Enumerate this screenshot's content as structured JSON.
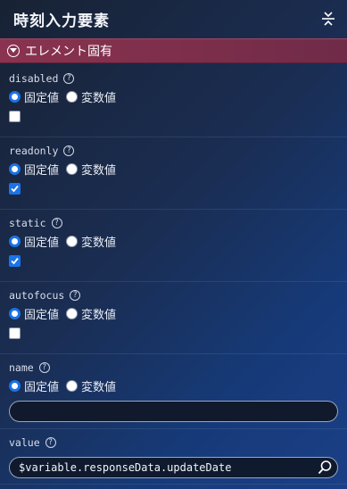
{
  "header": {
    "title": "時刻入力要素"
  },
  "section": {
    "label": "エレメント固有"
  },
  "radio_labels": {
    "fixed": "固定値",
    "variable": "変数値"
  },
  "help_glyph": "?",
  "properties": [
    {
      "name": "disabled",
      "mode": "fixed",
      "checked": false
    },
    {
      "name": "readonly",
      "mode": "fixed",
      "checked": true
    },
    {
      "name": "static",
      "mode": "fixed",
      "checked": true
    },
    {
      "name": "autofocus",
      "mode": "fixed",
      "checked": false
    },
    {
      "name": "name",
      "mode": "fixed",
      "input_value": ""
    },
    {
      "name": "value",
      "input_value": "$variable.responseData.updateDate"
    }
  ],
  "colors": {
    "accent": "#1a73e8",
    "section_bar": "#7b2e4a"
  }
}
